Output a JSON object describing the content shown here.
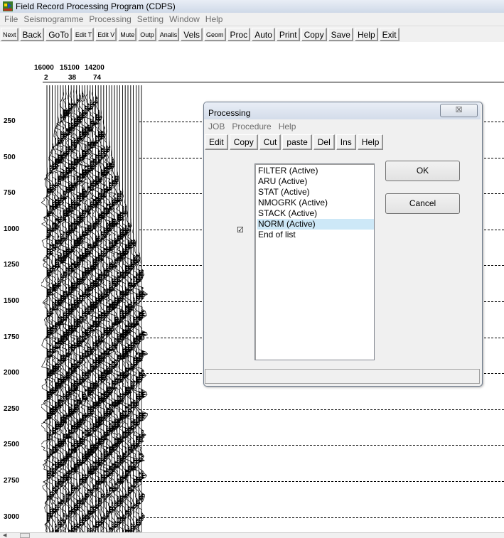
{
  "window": {
    "title": "Field Record Processing Program (CDPS)"
  },
  "menu": [
    "File",
    "Seismogramme",
    "Processing",
    "Setting",
    "Window",
    "Help"
  ],
  "toolbar": [
    {
      "label": "Next",
      "small": true
    },
    {
      "label": "Back",
      "small": false
    },
    {
      "label": "GoTo",
      "small": false
    },
    {
      "label": "Edit T",
      "small": true
    },
    {
      "label": "Edit V",
      "small": true
    },
    {
      "label": "Mute",
      "small": true
    },
    {
      "label": "Outp",
      "small": true
    },
    {
      "label": "Analis",
      "small": true
    },
    {
      "label": "Vels",
      "small": false
    },
    {
      "label": "Geom",
      "small": true
    },
    {
      "label": "Proc",
      "small": false
    },
    {
      "label": "Auto",
      "small": false
    },
    {
      "label": "Print",
      "small": false
    },
    {
      "label": "Copy",
      "small": false
    },
    {
      "label": "Save",
      "small": false
    },
    {
      "label": "Help",
      "small": false
    },
    {
      "label": "Exit",
      "small": false
    }
  ],
  "trace_header": {
    "row1": [
      "16000",
      "15100",
      "14200"
    ],
    "row2": [
      "2",
      "38",
      "74"
    ]
  },
  "time_axis": [
    "250",
    "500",
    "750",
    "1000",
    "1250",
    "1500",
    "1750",
    "2000",
    "2250",
    "2500",
    "2750",
    "3000"
  ],
  "dialog": {
    "title": "Processing",
    "close_glyph": "☒",
    "menu": [
      "JOB",
      "Procedure",
      "Help"
    ],
    "toolbar": [
      "Edit",
      "Copy",
      "Cut",
      "paste",
      "Del",
      "Ins",
      "Help"
    ],
    "procedures": [
      {
        "label": "FILTER (Active)",
        "selected": false
      },
      {
        "label": "ARU (Active)",
        "selected": false
      },
      {
        "label": "STAT (Active)",
        "selected": false
      },
      {
        "label": "NMOGRK (Active)",
        "selected": false
      },
      {
        "label": "STACK (Active)",
        "selected": false
      },
      {
        "label": "NORM (Active)",
        "selected": true
      },
      {
        "label": "End of list",
        "selected": false
      }
    ],
    "check_glyph": "☑",
    "ok_label": "OK",
    "cancel_label": "Cancel"
  },
  "colors": {
    "selection": "#cde8f7",
    "titlebar": "#dbe4f0"
  }
}
